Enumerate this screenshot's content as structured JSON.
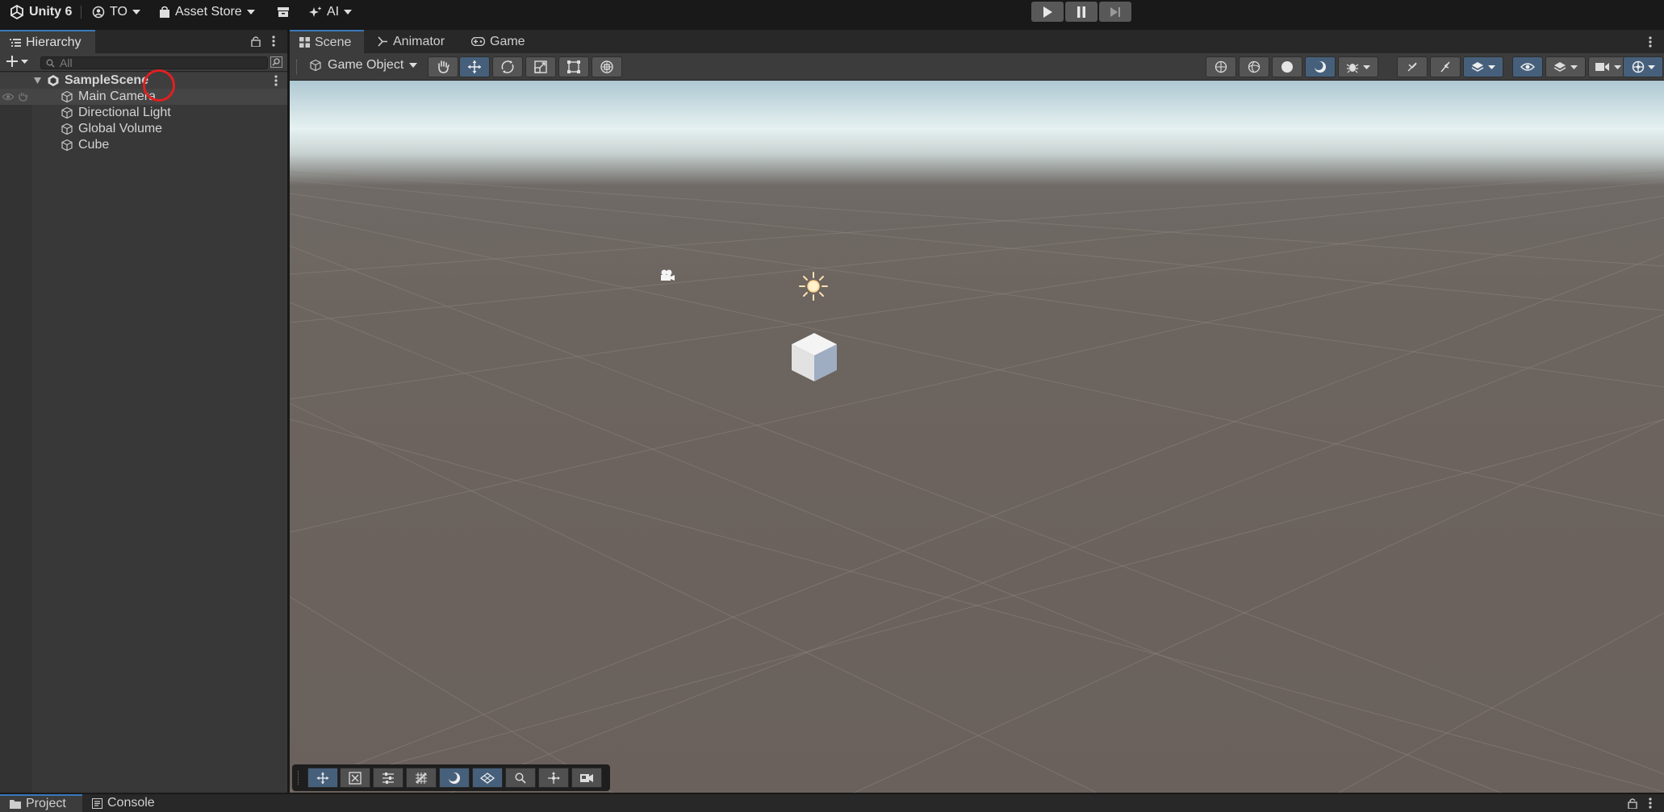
{
  "topbar": {
    "app_title": "Unity 6",
    "account_label": "TO",
    "asset_store_label": "Asset Store",
    "ai_label": "AI"
  },
  "hierarchy": {
    "tab_label": "Hierarchy",
    "search_placeholder": "All",
    "scene_name": "SampleScene",
    "items": [
      {
        "label": "Main Camera"
      },
      {
        "label": "Directional Light"
      },
      {
        "label": "Global Volume"
      },
      {
        "label": "Cube"
      }
    ]
  },
  "scene": {
    "tabs": [
      {
        "label": "Scene"
      },
      {
        "label": "Animator"
      },
      {
        "label": "Game"
      }
    ],
    "tool_context_label": "Game Object"
  },
  "bottom": {
    "tabs": [
      {
        "label": "Project"
      },
      {
        "label": "Console"
      }
    ]
  },
  "colors": {
    "accent": "#3a79bb",
    "active_button": "#46607c",
    "annotation_circle": "#e02020"
  }
}
